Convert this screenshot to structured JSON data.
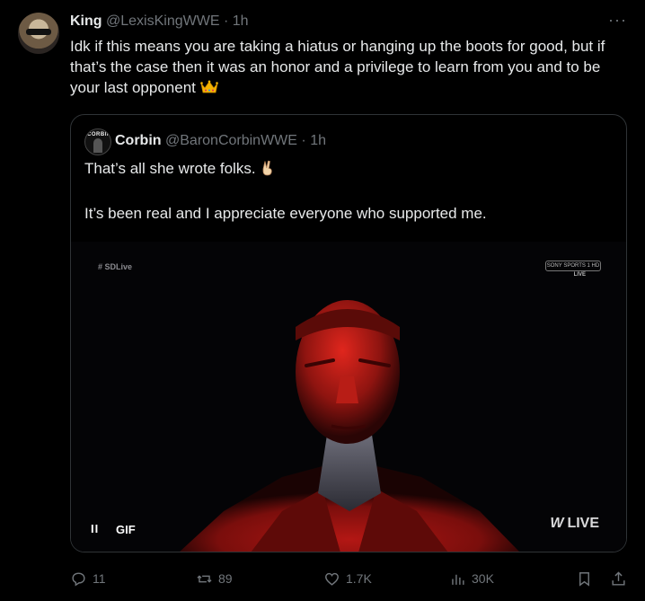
{
  "tweet": {
    "author_name": "King",
    "author_handle": "@LexisKingWWE",
    "dot": "·",
    "time": "1h",
    "more_icon": "more-icon",
    "text": "Idk if this means you are taking a hiatus or hanging up the boots for good, but if that’s the case then it was an honor and a privilege to learn from you and to be your last opponent",
    "text_emoji": "crown-icon"
  },
  "quote": {
    "author_name": "Corbin",
    "author_handle": "@BaronCorbinWWE",
    "dot": "·",
    "time": "1h",
    "line1": "That’s all she wrote folks.",
    "line1_emoji": "victory-hand-icon",
    "line2": "It’s been real and I appreciate everyone who supported me.",
    "avatar_logo": "CORBIN",
    "media": {
      "hashtag_overlay": "# SDLive",
      "channel_badge": "SONY SPORTS 1 HD",
      "channel_live": "LIVE",
      "gif_label": "GIF",
      "pause_label": "II",
      "broadcast_live": "LIVE",
      "broadcast_logo": "W"
    }
  },
  "actions": {
    "replies": "11",
    "reposts": "89",
    "likes": "1.7K",
    "views": "30K"
  },
  "colors": {
    "background": "#000000",
    "text": "#e7e9ea",
    "secondary": "#71767b",
    "border": "#2f3336",
    "red_light": "#d4201f"
  }
}
